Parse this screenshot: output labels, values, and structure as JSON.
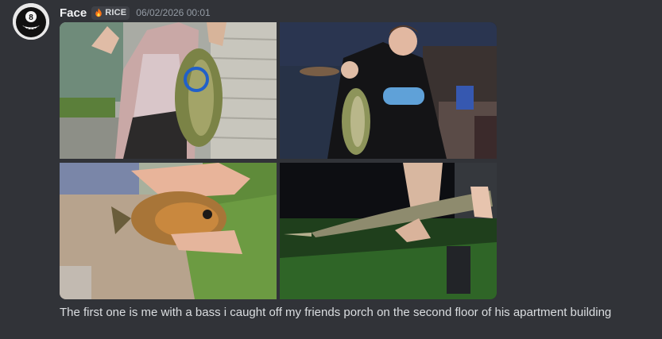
{
  "message": {
    "author": "Face",
    "tag_icon": "fire-icon",
    "tag": "RICE",
    "timestamp": "06/02/2026 00:01",
    "content": "The first one is me with a bass i caught off my friends porch on the second floor of his apartment building",
    "attachments": [
      {
        "name": "attachment-image-1",
        "subject": "largemouth bass held by person with pierced lip"
      },
      {
        "name": "attachment-image-2",
        "subject": "person holding bass at night by water"
      },
      {
        "name": "attachment-image-3",
        "subject": "sunfish held in hand over grass"
      },
      {
        "name": "attachment-image-4",
        "subject": "gar fish held at night over grass"
      }
    ]
  },
  "colors": {
    "background": "#313338",
    "username": "#f2f3f5",
    "text": "#dbdee1",
    "timestamp": "#949ba4",
    "tag_bg": "#3f4147",
    "accent_fire": "#f97316"
  }
}
